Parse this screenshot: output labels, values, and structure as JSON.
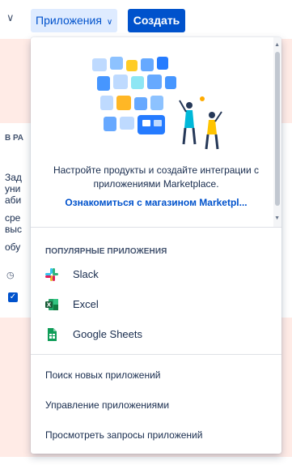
{
  "nav": {
    "prev_chevron": "∨",
    "apps_label": "Приложения",
    "apps_chevron": "∨",
    "create_label": "Создать"
  },
  "background": {
    "column_label": "В РА",
    "text_lines": [
      "Зад",
      "уни",
      "аби",
      "сре",
      "выс",
      "обу"
    ],
    "clock_glyph": "◷",
    "check_glyph": "✓"
  },
  "dropdown": {
    "promo": {
      "text": "Настройте продукты и создайте интеграции с приложениями Marketplace.",
      "link": "Ознакомиться с магазином Marketpl..."
    },
    "popular_heading": "ПОПУЛЯРНЫЕ ПРИЛОЖЕНИЯ",
    "apps": [
      {
        "label": "Slack",
        "icon": "slack-icon"
      },
      {
        "label": "Excel",
        "icon": "excel-icon"
      },
      {
        "label": "Google Sheets",
        "icon": "google-sheets-icon"
      }
    ],
    "menu": [
      {
        "label": "Поиск новых приложений"
      },
      {
        "label": "Управление приложениями"
      },
      {
        "label": "Просмотреть запросы приложений"
      }
    ]
  },
  "colors": {
    "brand": "#0052cc",
    "selected_bg": "#deebff",
    "bg_band": "#ffebe6",
    "excel": "#1d6f42",
    "sheets": "#0f9d58"
  }
}
